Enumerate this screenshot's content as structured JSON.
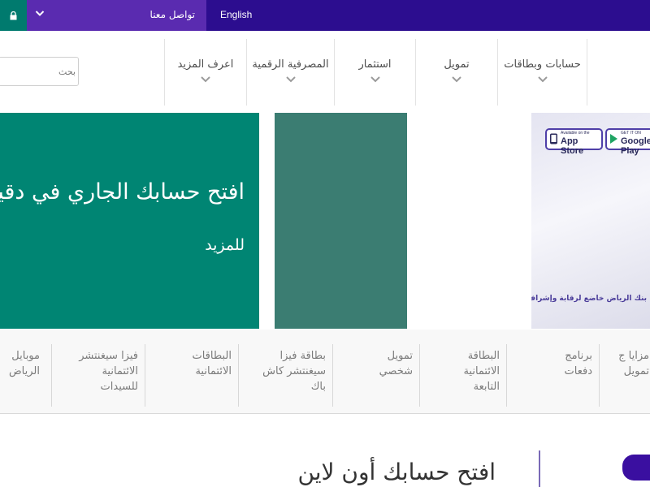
{
  "topbar": {
    "lang_label": "English",
    "contact_label": "تواصل معنا",
    "colors": {
      "bar": "#2c0d8f",
      "contact": "#5a2bb0",
      "lock": "#007a6e"
    }
  },
  "header": {
    "search_placeholder": "بحث",
    "nav": [
      {
        "label": "حسابات وبطاقات"
      },
      {
        "label": "تمويل"
      },
      {
        "label": "استثمار"
      },
      {
        "label": "المصرفية الرقمية"
      },
      {
        "label": "اعرف المزيد"
      }
    ]
  },
  "hero": {
    "title": "افتح حسابك الجاري في دقيقة",
    "more": "للمزيد",
    "app_store": {
      "small": "Available on the",
      "big": "App Store"
    },
    "google_play": {
      "small": "GET IT ON",
      "big": "Google Play"
    },
    "regulatory": "بنك الرياض خاضع لرقابة وإشراف مؤسسة النقد العربي السعودي",
    "colors": {
      "green": "#008573",
      "teal": "#3b7d72"
    }
  },
  "products": [
    {
      "label": "مزايا ج\nتمويل"
    },
    {
      "label": "برنامج\nدفعات"
    },
    {
      "label": "البطاقة\nالائتمانية\nالتابعة"
    },
    {
      "label": "تمويل\nشخصي"
    },
    {
      "label": "بطاقة فيزا\nسيغنتشر كاش\nباك"
    },
    {
      "label": "البطاقات\nالائتمانية"
    },
    {
      "label": "فيزا سيغنتشر\nالائتمانية\nللسيدات"
    },
    {
      "label": "موبايل\nالرياض"
    }
  ],
  "section": {
    "title": "افتح حسابك أون لاين"
  }
}
